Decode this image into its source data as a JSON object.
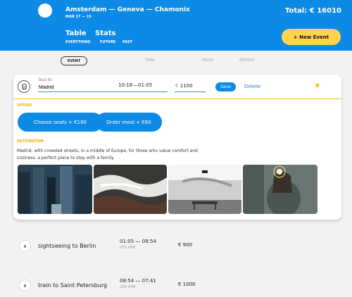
{
  "header": {
    "route": "Amsterdam — Geneva — Chamonix",
    "dates": "MAR 17 — 19",
    "total": "Total: € 16010",
    "tabs": [
      "Table",
      "Stats"
    ],
    "filters": [
      "EVERYTHING",
      "FUTURE",
      "PAST"
    ],
    "new_event_label": "+ New Event"
  },
  "sort": {
    "columns": [
      "EVENT",
      "TIME",
      "PRICE",
      "OFFERS"
    ],
    "active": "EVENT"
  },
  "edit_card": {
    "type_label": "bus to",
    "destination_value": "Madrid",
    "time_from": "10:18",
    "time_to": "—01:05",
    "price_prefix": "€",
    "price_value": "1100",
    "save_label": "Save",
    "delete_label": "Delete",
    "favorite_icon": "star-icon",
    "offers_title": "OFFERS",
    "offers": [
      "Choose seats + €190",
      "Order meal + €60"
    ],
    "destination_title": "DESTINATION",
    "description": "Madrid, with crowded streets, in a middle of Europe, for those who value comfort and coziness, a perfect place to stay with a family.",
    "photos": [
      "city-buildings-photo",
      "ocean-waves-photo",
      "bench-by-sea-photo",
      "sparkler-person-photo"
    ]
  },
  "events": [
    {
      "title": "sightseeing to Berlin",
      "time": "01:05 — 08:54",
      "duration": "07H 49M",
      "price": "€ 900"
    },
    {
      "title": "train to Saint Petersburg",
      "time": "08:54 — 07:41",
      "duration": "22H 47M",
      "price": "€ 1000"
    }
  ],
  "colors": {
    "primary": "#0d8ae6",
    "accent": "#ffd54f",
    "section": "#f0ad00",
    "background": "#f2f2f2"
  }
}
